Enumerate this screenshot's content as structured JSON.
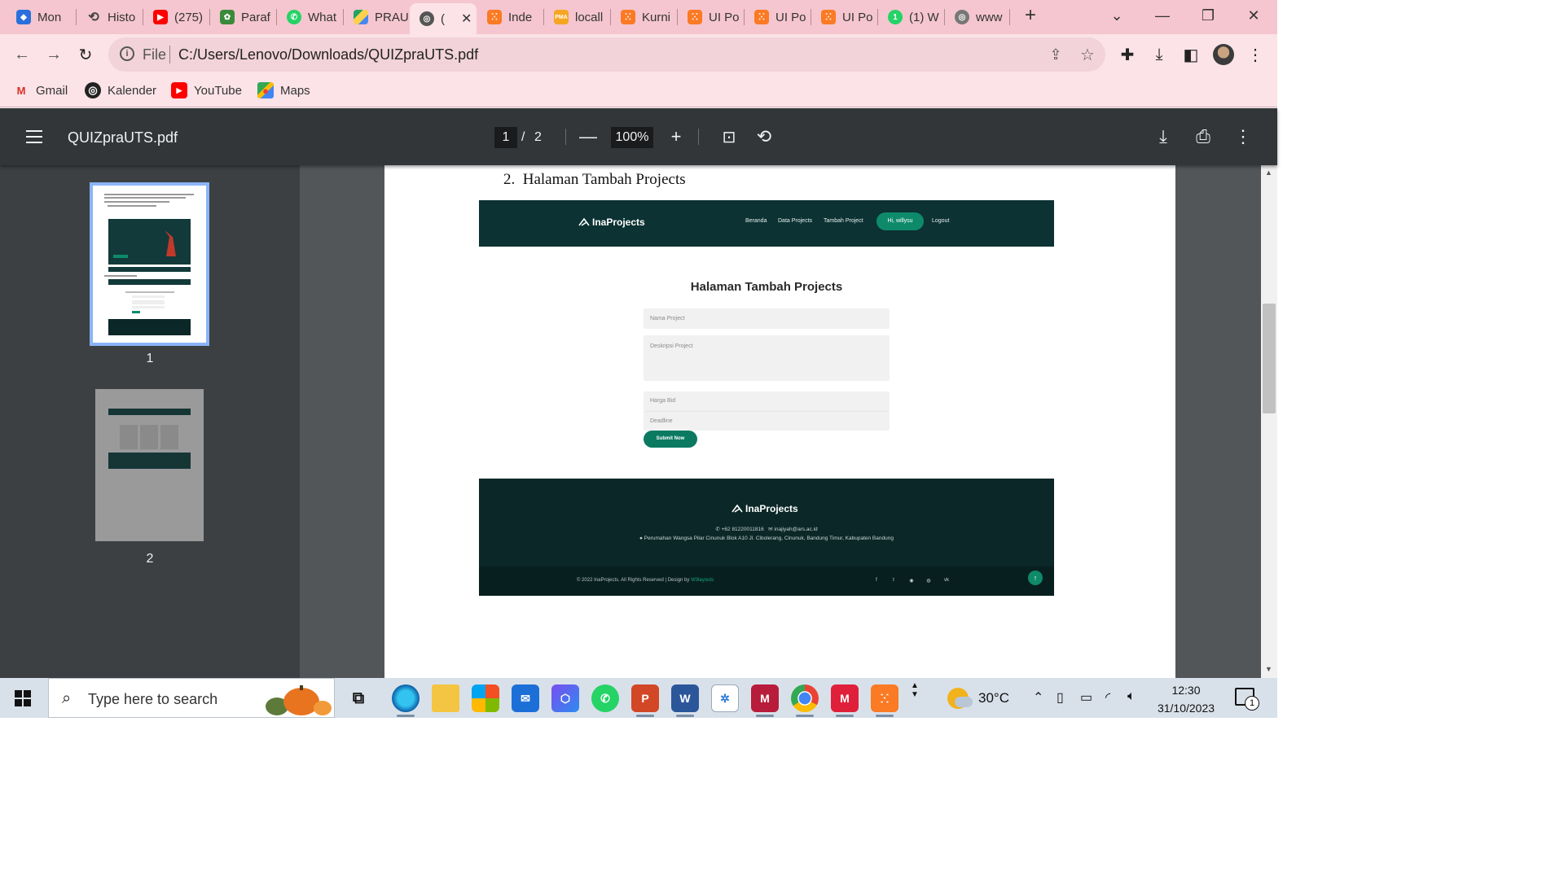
{
  "browser": {
    "tabs": [
      {
        "label": "Mon",
        "icon": "moodle-icon",
        "color": "#2a6fdb"
      },
      {
        "label": "Histo",
        "icon": "history-icon",
        "color": "#444444"
      },
      {
        "label": "(275)",
        "icon": "youtube-icon",
        "color": "#ff0000"
      },
      {
        "label": "Paraf",
        "icon": "leaf-icon",
        "color": "#3a8a3a"
      },
      {
        "label": "What",
        "icon": "whatsapp-icon",
        "color": "#25d366"
      },
      {
        "label": "PRAU",
        "icon": "google-drive-icon",
        "color": "#1fa463"
      },
      {
        "label": "(",
        "icon": "globe-icon",
        "color": "#555555",
        "active": true
      },
      {
        "label": "Inde",
        "icon": "xampp-icon",
        "color": "#fb7a24"
      },
      {
        "label": "locall",
        "icon": "phpmyadmin-icon",
        "color": "#f5a623"
      },
      {
        "label": "Kurni",
        "icon": "xampp-icon",
        "color": "#fb7a24"
      },
      {
        "label": "UI Po",
        "icon": "xampp-icon",
        "color": "#fb7a24"
      },
      {
        "label": "UI Po",
        "icon": "xampp-icon",
        "color": "#fb7a24"
      },
      {
        "label": "UI Po",
        "icon": "xampp-icon",
        "color": "#fb7a24"
      },
      {
        "label": "(1) W",
        "icon": "whatsapp-icon",
        "color": "#25d366"
      },
      {
        "label": "www",
        "icon": "globe-icon",
        "color": "#777777"
      }
    ],
    "new_tab": "+",
    "address": {
      "scheme": "File",
      "url": "C:/Users/Lenovo/Downloads/QUIZpraUTS.pdf"
    },
    "bookmarks": [
      {
        "label": "Gmail",
        "icon": "gmail-icon"
      },
      {
        "label": "Kalender",
        "icon": "globe-icon"
      },
      {
        "label": "YouTube",
        "icon": "youtube-icon"
      },
      {
        "label": "Maps",
        "icon": "maps-icon"
      }
    ]
  },
  "pdf": {
    "filename": "QUIZpraUTS.pdf",
    "current_page": "1",
    "page_sep": "/",
    "total_pages": "2",
    "zoom": "100%",
    "thumbnails": [
      {
        "label": "1"
      },
      {
        "label": "2"
      }
    ]
  },
  "document": {
    "section_number": "2.",
    "section_title": "Halaman Tambah Projects",
    "site": {
      "brand": "InaProjects",
      "nav": [
        "Beranda",
        "Data Projects",
        "Tambah Project"
      ],
      "user_pill": "Hi, willysu",
      "logout": "Logout",
      "form_title": "Halaman Tambah Projects",
      "fields": {
        "name": "Nama Project",
        "description": "Deskripsi Project",
        "bid": "Harga Bid",
        "deadline": "Deadline"
      },
      "submit": "Submit Now",
      "footer": {
        "brand": "InaProjects",
        "phone": "+62 81220011816",
        "email": "inajiyah@ars.ac.id",
        "address": "Perumahan Wangsa Pilar Cinunuk Blok A10 Jl. Cibolerang, Cinunuk, Bandung Timur, Kabupaten Bandung",
        "copyright": "© 2022 InaProjects. All Rights Reserved | Design by",
        "designer": "W3layouts",
        "social": [
          "facebook-icon",
          "twitter-icon",
          "instagram-icon",
          "dribbble-icon",
          "vk-icon"
        ]
      }
    }
  },
  "taskbar": {
    "search_placeholder": "Type here to search",
    "weather": "30°C",
    "time": "12:30",
    "date": "31/10/2023",
    "notifications": "1"
  }
}
